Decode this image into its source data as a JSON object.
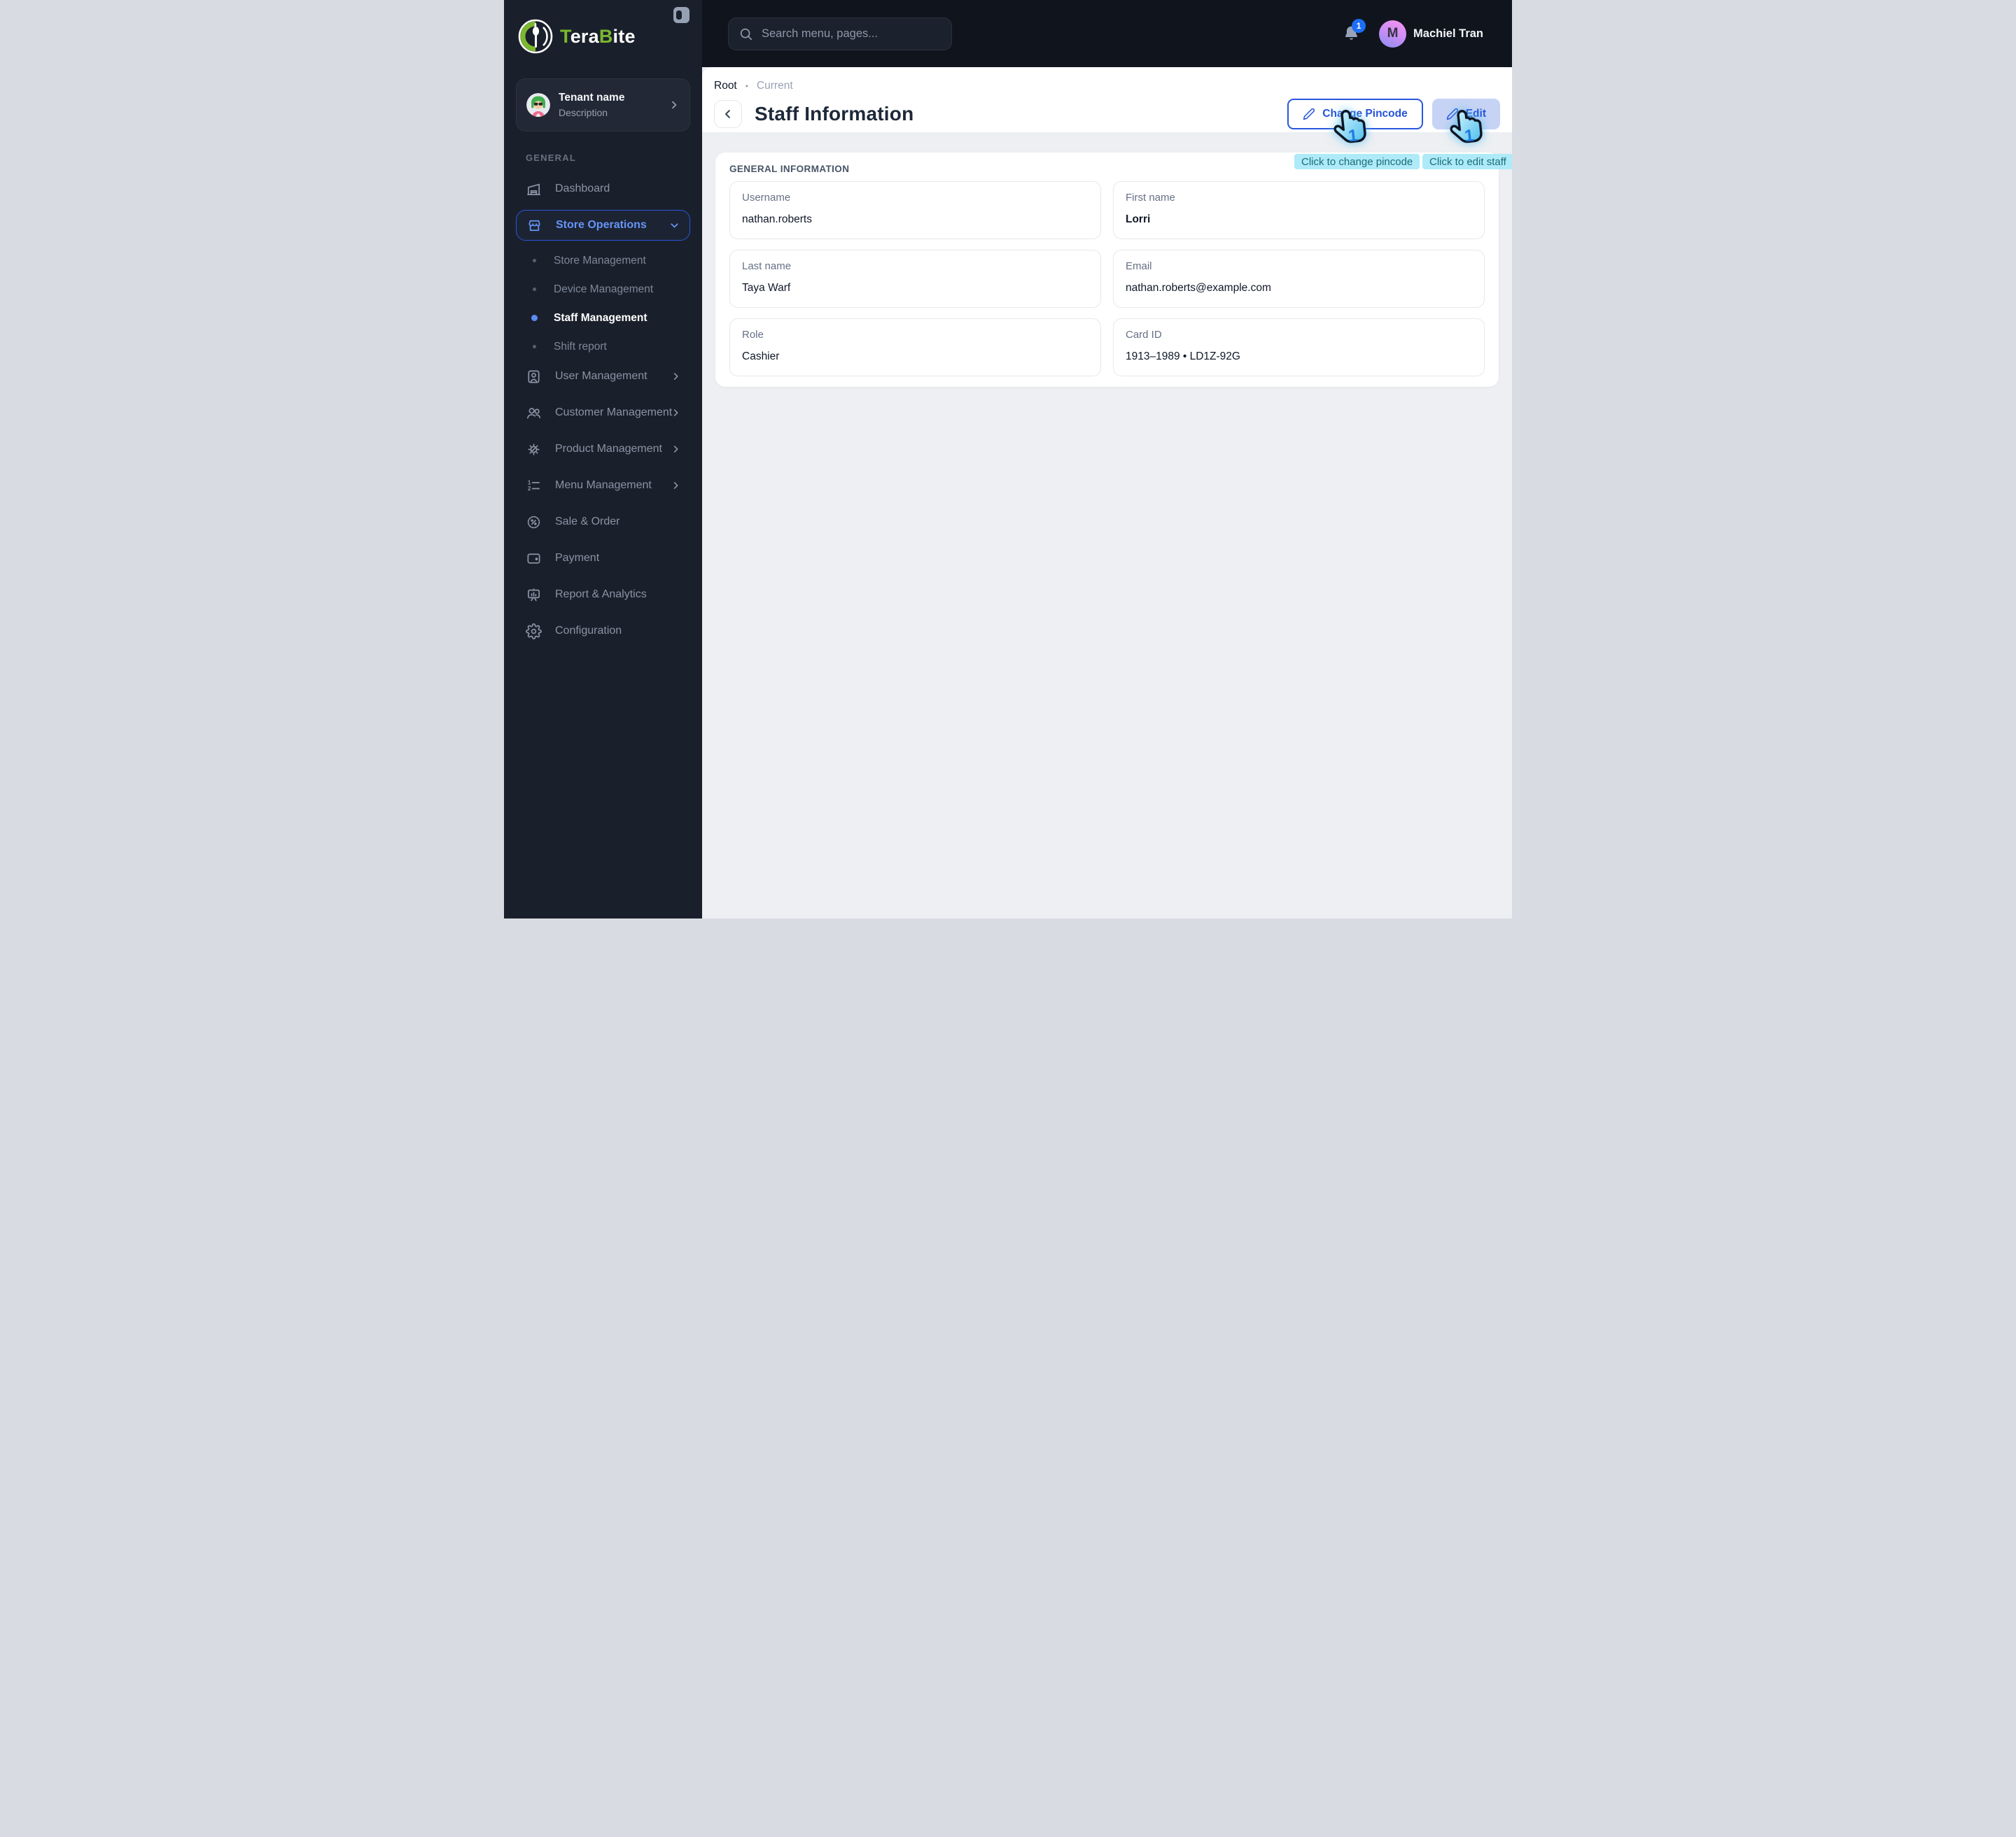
{
  "brand": {
    "accent1": "T",
    "rest1": "era",
    "accent2": "B",
    "rest2": "ite"
  },
  "sidebar": {
    "tenant": {
      "name": "Tenant name",
      "description": "Description"
    },
    "section_label": "GENERAL",
    "items": [
      {
        "type": "link",
        "icon": "dashboard",
        "label": "Dashboard"
      },
      {
        "type": "parent",
        "icon": "store",
        "label": "Store Operations",
        "active": true,
        "chevron": "down"
      },
      {
        "type": "sub",
        "label": "Store Management"
      },
      {
        "type": "sub",
        "label": "Device Management"
      },
      {
        "type": "sub",
        "label": "Staff Management",
        "active": true
      },
      {
        "type": "sub",
        "label": "Shift report"
      },
      {
        "type": "link",
        "icon": "user",
        "label": "User Management",
        "chevron": "right"
      },
      {
        "type": "link",
        "icon": "customers",
        "label": "Customer Management",
        "chevron": "right"
      },
      {
        "type": "link",
        "icon": "product",
        "label": "Product Management",
        "chevron": "right"
      },
      {
        "type": "link",
        "icon": "menu",
        "label": "Menu Management",
        "chevron": "right"
      },
      {
        "type": "link",
        "icon": "sale",
        "label": "Sale & Order"
      },
      {
        "type": "link",
        "icon": "payment",
        "label": "Payment"
      },
      {
        "type": "link",
        "icon": "report",
        "label": "Report & Analytics"
      },
      {
        "type": "link",
        "icon": "config",
        "label": "Configuration"
      }
    ]
  },
  "header": {
    "search_placeholder": "Search menu, pages...",
    "notification_count": "1",
    "avatar_initial": "M",
    "user_name": "Machiel Tran"
  },
  "page": {
    "breadcrumb": {
      "root": "Root",
      "separator": "•",
      "current": "Current"
    },
    "title": "Staff Information",
    "actions": {
      "change_pincode": "Change Pincode",
      "edit": "Edit"
    },
    "tooltips": {
      "change_pincode": "Click to change pincode",
      "edit": "Click to edit staff"
    },
    "cursor_badge": "1",
    "section_title": "GENERAL INFORMATION",
    "fields": [
      {
        "label": "Username",
        "value": "nathan.roberts"
      },
      {
        "label": "First name",
        "value": "Lorri",
        "bold": true
      },
      {
        "label": "Last name",
        "value": "Taya Warf"
      },
      {
        "label": "Email",
        "value": "nathan.roberts@example.com"
      },
      {
        "label": "Role",
        "value": "Cashier"
      },
      {
        "label": "Card ID",
        "value": "1913–1989 • LD1Z-92G"
      }
    ]
  },
  "colors": {
    "sidebar-bg": "#1a202b",
    "header-bg": "#10141d",
    "content-bg": "#edeff2",
    "accent-blue": "#2856de",
    "accent-blue-text": "#2453d9",
    "sidebar-active-text": "#6695f7",
    "edit-btn-bg": "#c6d3f4",
    "tooltip-bg": "#aeeaf8",
    "tooltip-text": "#186d78",
    "badge-blue": "#1d6ef5",
    "logo-green": "#7cb82f"
  }
}
